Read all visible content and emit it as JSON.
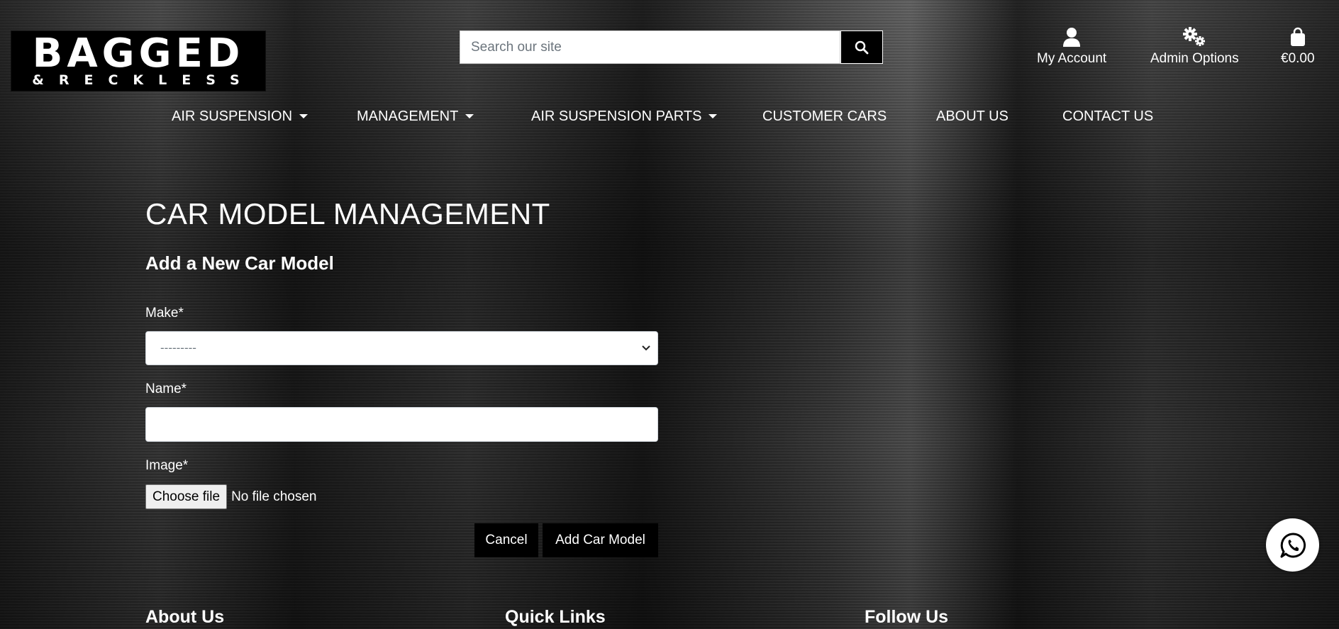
{
  "brand": {
    "logo_main": "BAGGED",
    "logo_sub": "&RECKLESS"
  },
  "search": {
    "placeholder": "Search our site"
  },
  "header": {
    "account_label": "My Account",
    "admin_label": "Admin Options",
    "cart_total": "€0.00"
  },
  "nav": {
    "items": [
      {
        "label": "AIR SUSPENSION",
        "dropdown": true
      },
      {
        "label": "MANAGEMENT",
        "dropdown": true
      },
      {
        "label": "AIR SUSPENSION PARTS",
        "dropdown": true
      },
      {
        "label": "CUSTOMER CARS",
        "dropdown": false
      },
      {
        "label": "ABOUT US",
        "dropdown": false
      },
      {
        "label": "CONTACT US",
        "dropdown": false
      }
    ]
  },
  "main": {
    "title": "CAR MODEL MANAGEMENT",
    "subtitle": "Add a New Car Model",
    "form": {
      "make_label": "Make*",
      "make_selected": "---------",
      "name_label": "Name*",
      "name_value": "",
      "image_label": "Image*",
      "file_button": "Choose file",
      "file_status": "No file chosen",
      "cancel_label": "Cancel",
      "submit_label": "Add Car Model"
    }
  },
  "footer": {
    "headings": [
      "About Us",
      "Quick Links",
      "Follow Us"
    ]
  }
}
